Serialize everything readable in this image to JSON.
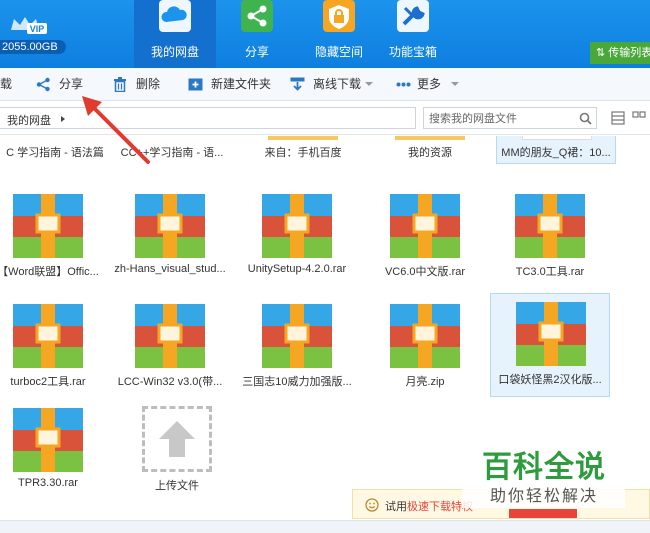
{
  "header": {
    "vip_badge": "VIP",
    "quota": "2055.00GB",
    "tabs": [
      {
        "label": "我的网盘",
        "icon": "cloud-icon",
        "active": true
      },
      {
        "label": "分享",
        "icon": "share-icon",
        "active": false
      },
      {
        "label": "隐藏空间",
        "icon": "lock-icon",
        "active": false
      },
      {
        "label": "功能宝箱",
        "icon": "toolbox-icon",
        "active": false
      }
    ],
    "transfer_label": "传输列表"
  },
  "toolbar": {
    "download_label": "载",
    "share_label": "分享",
    "delete_label": "删除",
    "new_folder_label": "新建文件夹",
    "offline_label": "离线下载",
    "more_label": "更多"
  },
  "address": {
    "breadcrumb": "我的网盘",
    "search_placeholder": "搜索我的网盘文件"
  },
  "partial_row": [
    {
      "name": "C  学习指南 - 语法篇"
    },
    {
      "name": "CC++学习指南 - 语..."
    },
    {
      "name": "来自：手机百度"
    },
    {
      "name": "我的资源"
    },
    {
      "name": "MM的朋友_Q裙：10..."
    }
  ],
  "files": [
    {
      "name": "【Word联盟】Offic..."
    },
    {
      "name": "zh-Hans_visual_stud..."
    },
    {
      "name": "UnitySetup-4.2.0.rar"
    },
    {
      "name": "VC6.0中文版.rar"
    },
    {
      "name": "TC3.0工具.rar"
    },
    {
      "name": "turboc2工具.rar"
    },
    {
      "name": "LCC-Win32 v3.0(带..."
    },
    {
      "name": "三国志10威力加强版..."
    },
    {
      "name": "月亮.zip"
    },
    {
      "name": "口袋妖怪黑2汉化版..."
    },
    {
      "name": "TPR3.30.rar"
    }
  ],
  "upload_label": "上传文件",
  "trial": {
    "prefix": "试用",
    "highlight": "极速下载特权"
  },
  "watermark": {
    "main": "百科全说",
    "sub": "助你轻松解决"
  },
  "colors": {
    "header_blue": "#1c93ec",
    "active_tab": "#1370cf",
    "transfer_green": "#49a83a",
    "archive_blue": "#35a7e6",
    "archive_red": "#d9533a",
    "archive_green": "#7cc242",
    "archive_orange": "#f5a623"
  }
}
